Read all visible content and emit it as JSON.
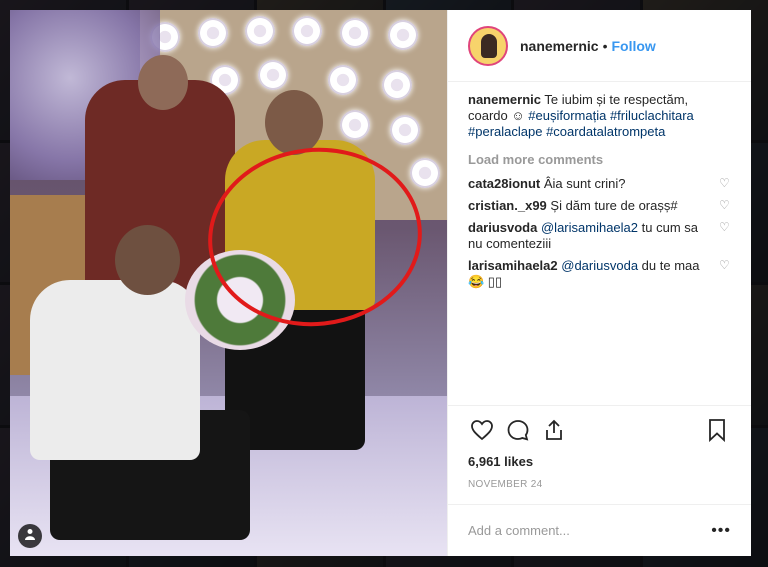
{
  "post": {
    "username": "nanemernic",
    "follow_label": "Follow",
    "separator": "•"
  },
  "caption": {
    "username": "nanemernic",
    "text": "Te iubim și te respectăm, coardo",
    "emoji": "☺",
    "hashtags": [
      "#eușiformația",
      "#friluclachitara",
      "#peralaclape",
      "#coardatalatrompeta"
    ]
  },
  "load_more_label": "Load more comments",
  "comments": [
    {
      "user": "cata28ionut",
      "mention": "",
      "text": "Âia sunt crini?"
    },
    {
      "user": "cristian._x99",
      "mention": "",
      "text": "Și dăm ture de orașș#"
    },
    {
      "user": "dariusvoda",
      "mention": "@larisamihaela2",
      "text": "tu cum sa nu comenteziii"
    },
    {
      "user": "larisamihaela2",
      "mention": "@dariusvoda",
      "text": "du te maa😂 ▯▯"
    }
  ],
  "likes": "6,961 likes",
  "date": "NOVEMBER 24",
  "add_comment_placeholder": "Add a comment...",
  "more_label": "•••",
  "icons": {
    "like": "heart-icon",
    "comment": "comment-icon",
    "share": "share-icon",
    "save": "bookmark-icon",
    "tag": "user-tag-icon"
  },
  "colors": {
    "link": "#3897f0",
    "hashtag": "#003569",
    "highlight_ring": "#e11a1a"
  }
}
